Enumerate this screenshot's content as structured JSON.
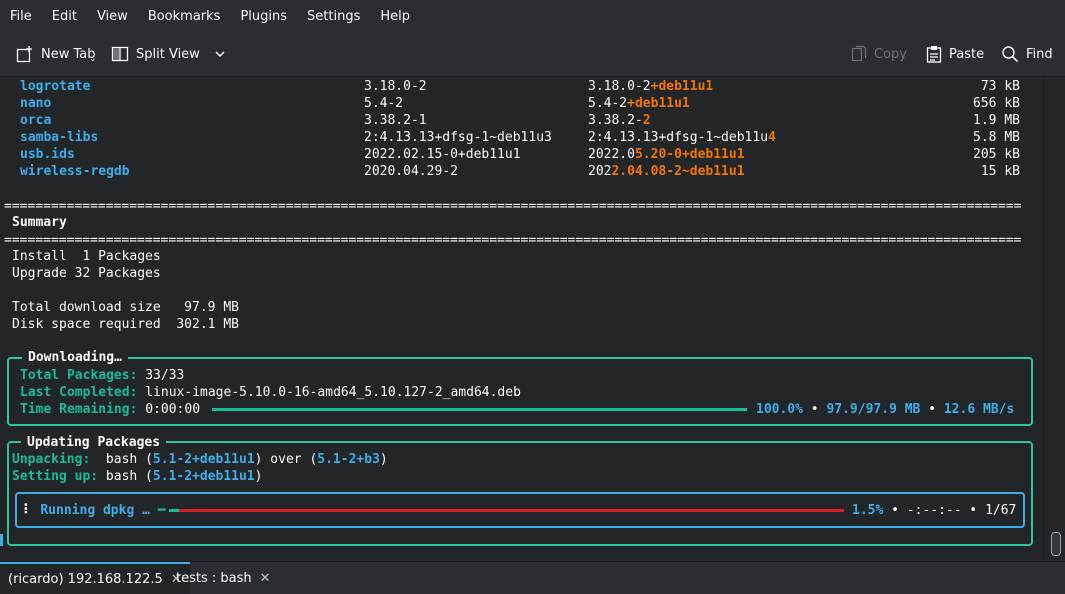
{
  "menu": [
    "File",
    "Edit",
    "View",
    "Bookmarks",
    "Plugins",
    "Settings",
    "Help"
  ],
  "toolbar": {
    "new_tab": "New Tab",
    "split_view": "Split View",
    "copy": "Copy",
    "paste": "Paste",
    "find": "Find"
  },
  "packages": [
    {
      "name": "logrotate",
      "current": "3.18.0-2",
      "new_base": "3.18.0-2",
      "new_hl": "+deb11u1",
      "size": "73 kB"
    },
    {
      "name": "nano",
      "current": "5.4-2",
      "new_base": "5.4-2",
      "new_hl": "+deb11u1",
      "size": "656 kB"
    },
    {
      "name": "orca",
      "current": "3.38.2-1",
      "new_base": "3.38.2-",
      "new_hl": "2",
      "size": "1.9 MB"
    },
    {
      "name": "samba-libs",
      "current": "2:4.13.13+dfsg-1~deb11u3",
      "new_base": "2:4.13.13+dfsg-1~deb11u",
      "new_hl": "4",
      "size": "5.8 MB"
    },
    {
      "name": "usb.ids",
      "current": "2022.02.15-0+deb11u1",
      "new_base": "2022.0",
      "new_hl": "5.20-0+deb11u1",
      "size": "205 kB"
    },
    {
      "name": "wireless-regdb",
      "current": "2020.04.29-2",
      "new_base": "202",
      "new_hl": "2.04.08-2~deb11u1",
      "size": "15 kB"
    }
  ],
  "separator": "==================================================================================================================================",
  "summary": {
    "title": "Summary",
    "install": "Install  1 Packages",
    "upgrade": "Upgrade 32 Packages",
    "download": "Total download size   97.9 MB",
    "disk": "Disk space required  302.1 MB"
  },
  "downloading": {
    "title": "Downloading…",
    "total_label": "Total Packages:",
    "total_value": "33/33",
    "last_label": "Last Completed:",
    "last_value": "linux-image-5.10.0-16-amd64_5.10.127-2_amd64.deb",
    "time_label": "Time Remaining:",
    "time_value": "0:00:00",
    "progress": 1.0,
    "percent": "100.0%",
    "bytes": "97.9/97.9 MB",
    "speed": "12.6 MB/s",
    "dot": "•"
  },
  "updating": {
    "title": "Updating Packages",
    "unpack_label": "Unpacking:",
    "unpack_pre": "  bash (",
    "unpack_v1": "5.1-2+deb11u1",
    "unpack_mid": ") over (",
    "unpack_v2": "5.1-2+b3",
    "unpack_end": ")",
    "setup_label": "Setting up:",
    "setup_pre": " bash (",
    "setup_v": "5.1-2+deb11u1",
    "setup_end": ")",
    "spinner": "⠇",
    "running": "Running dpkg …",
    "dash": "━",
    "progress": 0.015,
    "percent": "1.5%",
    "eta": "-:--:--",
    "count": "1/67",
    "dot": "•"
  },
  "tabs": [
    {
      "label": "(ricardo) 192.168.122.5"
    },
    {
      "label": "tests : bash"
    }
  ],
  "colors": {
    "accent": "#3daee9",
    "orange": "#f67400",
    "green": "#1abc9c",
    "red": "#da1e28"
  }
}
